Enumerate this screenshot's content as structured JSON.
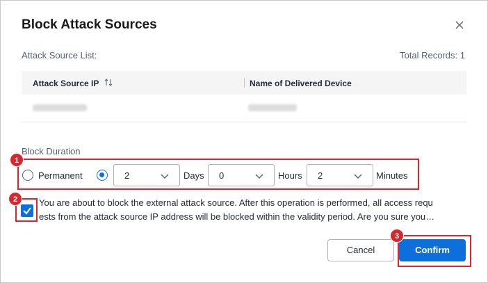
{
  "dialog": {
    "title": "Block Attack Sources"
  },
  "list": {
    "label": "Attack Source List:",
    "total": "Total Records: 1",
    "columns": [
      "Attack Source IP",
      "Name of Delivered Device"
    ]
  },
  "duration": {
    "label": "Block Duration",
    "permanent_label": "Permanent",
    "days_value": "2",
    "days_label": "Days",
    "hours_value": "0",
    "hours_label": "Hours",
    "minutes_value": "2",
    "minutes_label": "Minutes",
    "selected_option": "custom"
  },
  "confirm_text": {
    "line1": "You are about to block the external attack source. After this operation is performed, all access requ",
    "line2": "ests from the attack source IP address will be blocked within the validity period. Are you sure you…",
    "checked": true
  },
  "buttons": {
    "cancel": "Cancel",
    "confirm": "Confirm"
  },
  "badges": [
    "1",
    "2",
    "3"
  ],
  "colors": {
    "accent": "#0d6fdc",
    "highlight": "#e0232c"
  },
  "icons": {
    "close": "close-icon",
    "sort": "sort-icon",
    "chevron": "chevron-down-icon",
    "check": "check-icon"
  }
}
